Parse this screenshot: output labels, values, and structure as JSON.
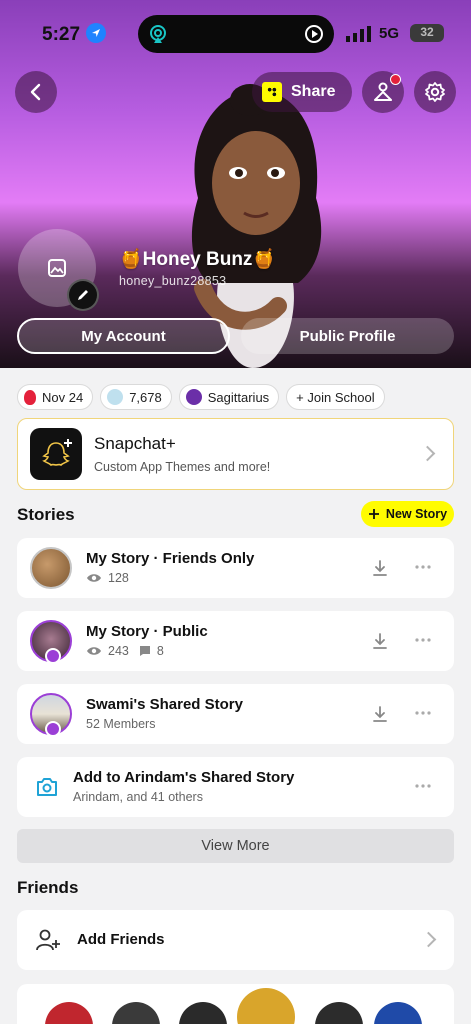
{
  "status_bar": {
    "time": "5:27",
    "network": "5G",
    "battery": "32"
  },
  "header": {
    "share_label": "Share"
  },
  "profile": {
    "display_name": "🍯Honey Bunz🍯",
    "username": "honey_bunz28853"
  },
  "tabs": [
    {
      "label": "My Account"
    },
    {
      "label": "Public Profile"
    }
  ],
  "chips": [
    {
      "label": "Nov 24",
      "icon": "balloon-icon"
    },
    {
      "label": "7,678",
      "icon": "snap-score-icon"
    },
    {
      "label": "Sagittarius",
      "icon": "zodiac-icon"
    },
    {
      "label": "+ Join School",
      "icon": ""
    }
  ],
  "snapchat_plus": {
    "title": "Snapchat+",
    "subtitle": "Custom App Themes and more!"
  },
  "stories": {
    "section_title": "Stories",
    "new_story_label": "New Story",
    "items": [
      {
        "title": "My Story · Friends Only",
        "views": "128"
      },
      {
        "title": "My Story · Public",
        "views": "243",
        "replies": "8"
      },
      {
        "title": "Swami's Shared Story",
        "meta": "52 Members"
      },
      {
        "title": "Add to Arindam's Shared Story",
        "meta": "Arindam, and 41 others"
      }
    ],
    "view_more_label": "View More"
  },
  "friends": {
    "section_title": "Friends",
    "add_friends_label": "Add Friends"
  },
  "colors": {
    "accent_yellow": "#fffc00",
    "story_purple": "#9b3fd6",
    "notification_red": "#e4213b"
  }
}
